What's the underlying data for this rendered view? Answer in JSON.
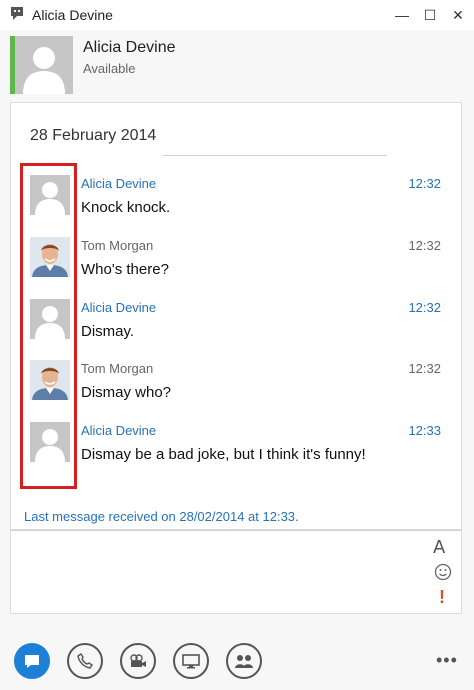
{
  "window": {
    "title": "Alicia Devine",
    "controls": {
      "minimize": "—",
      "maximize": "☐",
      "close": "✕"
    }
  },
  "contact": {
    "name": "Alicia Devine",
    "status": "Available",
    "presence_color": "#5db945"
  },
  "conversation": {
    "date": "28 February 2014",
    "messages": [
      {
        "sender": "Alicia Devine",
        "time": "12:32",
        "text": "Knock knock.",
        "self": false
      },
      {
        "sender": "Tom Morgan",
        "time": "12:32",
        "text": "Who's there?",
        "self": true
      },
      {
        "sender": "Alicia Devine",
        "time": "12:32",
        "text": "Dismay.",
        "self": false
      },
      {
        "sender": "Tom Morgan",
        "time": "12:32",
        "text": "Dismay who?",
        "self": true
      },
      {
        "sender": "Alicia Devine",
        "time": "12:33",
        "text": "Dismay be a bad joke, but I think it's funny!",
        "self": false
      }
    ],
    "last_message_note": "Last message received on 28/02/2014 at 12:33."
  },
  "compose": {
    "placeholder": "",
    "icons": [
      "font-format-icon",
      "emoticon-icon",
      "high-importance-icon"
    ],
    "font_label": "A",
    "importance_label": "!"
  },
  "toolbar": {
    "buttons": [
      "im-icon",
      "phone-icon",
      "video-icon",
      "present-icon",
      "participants-icon"
    ],
    "more_label": "•••"
  },
  "colors": {
    "link_blue": "#2672b9",
    "highlight_red": "#d42020",
    "active_blue": "#1e7fd6"
  }
}
